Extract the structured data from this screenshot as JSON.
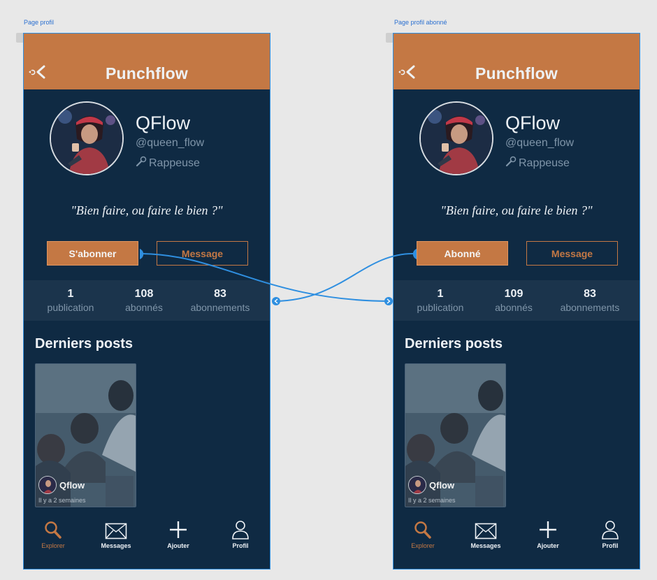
{
  "artboards": [
    {
      "label": "Page profil",
      "app_title": "Punchflow",
      "profile": {
        "name": "QFlow",
        "handle": "@queen_flow",
        "role": "Rappeuse"
      },
      "quote": "\"Bien faire, ou faire le bien ?\"",
      "buttons": {
        "primary": "S'abonner",
        "secondary": "Message"
      },
      "stats": [
        {
          "value": "1",
          "label": "publication"
        },
        {
          "value": "108",
          "label": "abonnés"
        },
        {
          "value": "83",
          "label": "abonnements"
        }
      ],
      "section_title": "Derniers posts",
      "post": {
        "author": "Qflow",
        "time": "Il y a 2 semaines"
      },
      "nav": [
        {
          "label": "Explorer",
          "icon": "search-icon"
        },
        {
          "label": "Messages",
          "icon": "envelope-icon"
        },
        {
          "label": "Ajouter",
          "icon": "plus-icon"
        },
        {
          "label": "Profil",
          "icon": "user-icon"
        }
      ]
    },
    {
      "label": "Page profil abonné",
      "app_title": "Punchflow",
      "profile": {
        "name": "QFlow",
        "handle": "@queen_flow",
        "role": "Rappeuse"
      },
      "quote": "\"Bien faire, ou faire le bien ?\"",
      "buttons": {
        "primary": "Abonné",
        "secondary": "Message"
      },
      "stats": [
        {
          "value": "1",
          "label": "publication"
        },
        {
          "value": "109",
          "label": "abonnés"
        },
        {
          "value": "83",
          "label": "abonnements"
        }
      ],
      "section_title": "Derniers posts",
      "post": {
        "author": "Qflow",
        "time": "Il y a 2 semaines"
      },
      "nav": [
        {
          "label": "Explorer",
          "icon": "search-icon"
        },
        {
          "label": "Messages",
          "icon": "envelope-icon"
        },
        {
          "label": "Ajouter",
          "icon": "plus-icon"
        },
        {
          "label": "Profil",
          "icon": "user-icon"
        }
      ]
    }
  ],
  "colors": {
    "header": "#c47844",
    "background": "#0f2a43",
    "stats_bar": "#1b344c",
    "accent": "#c47844",
    "prototype_link": "#2f8fe0"
  }
}
